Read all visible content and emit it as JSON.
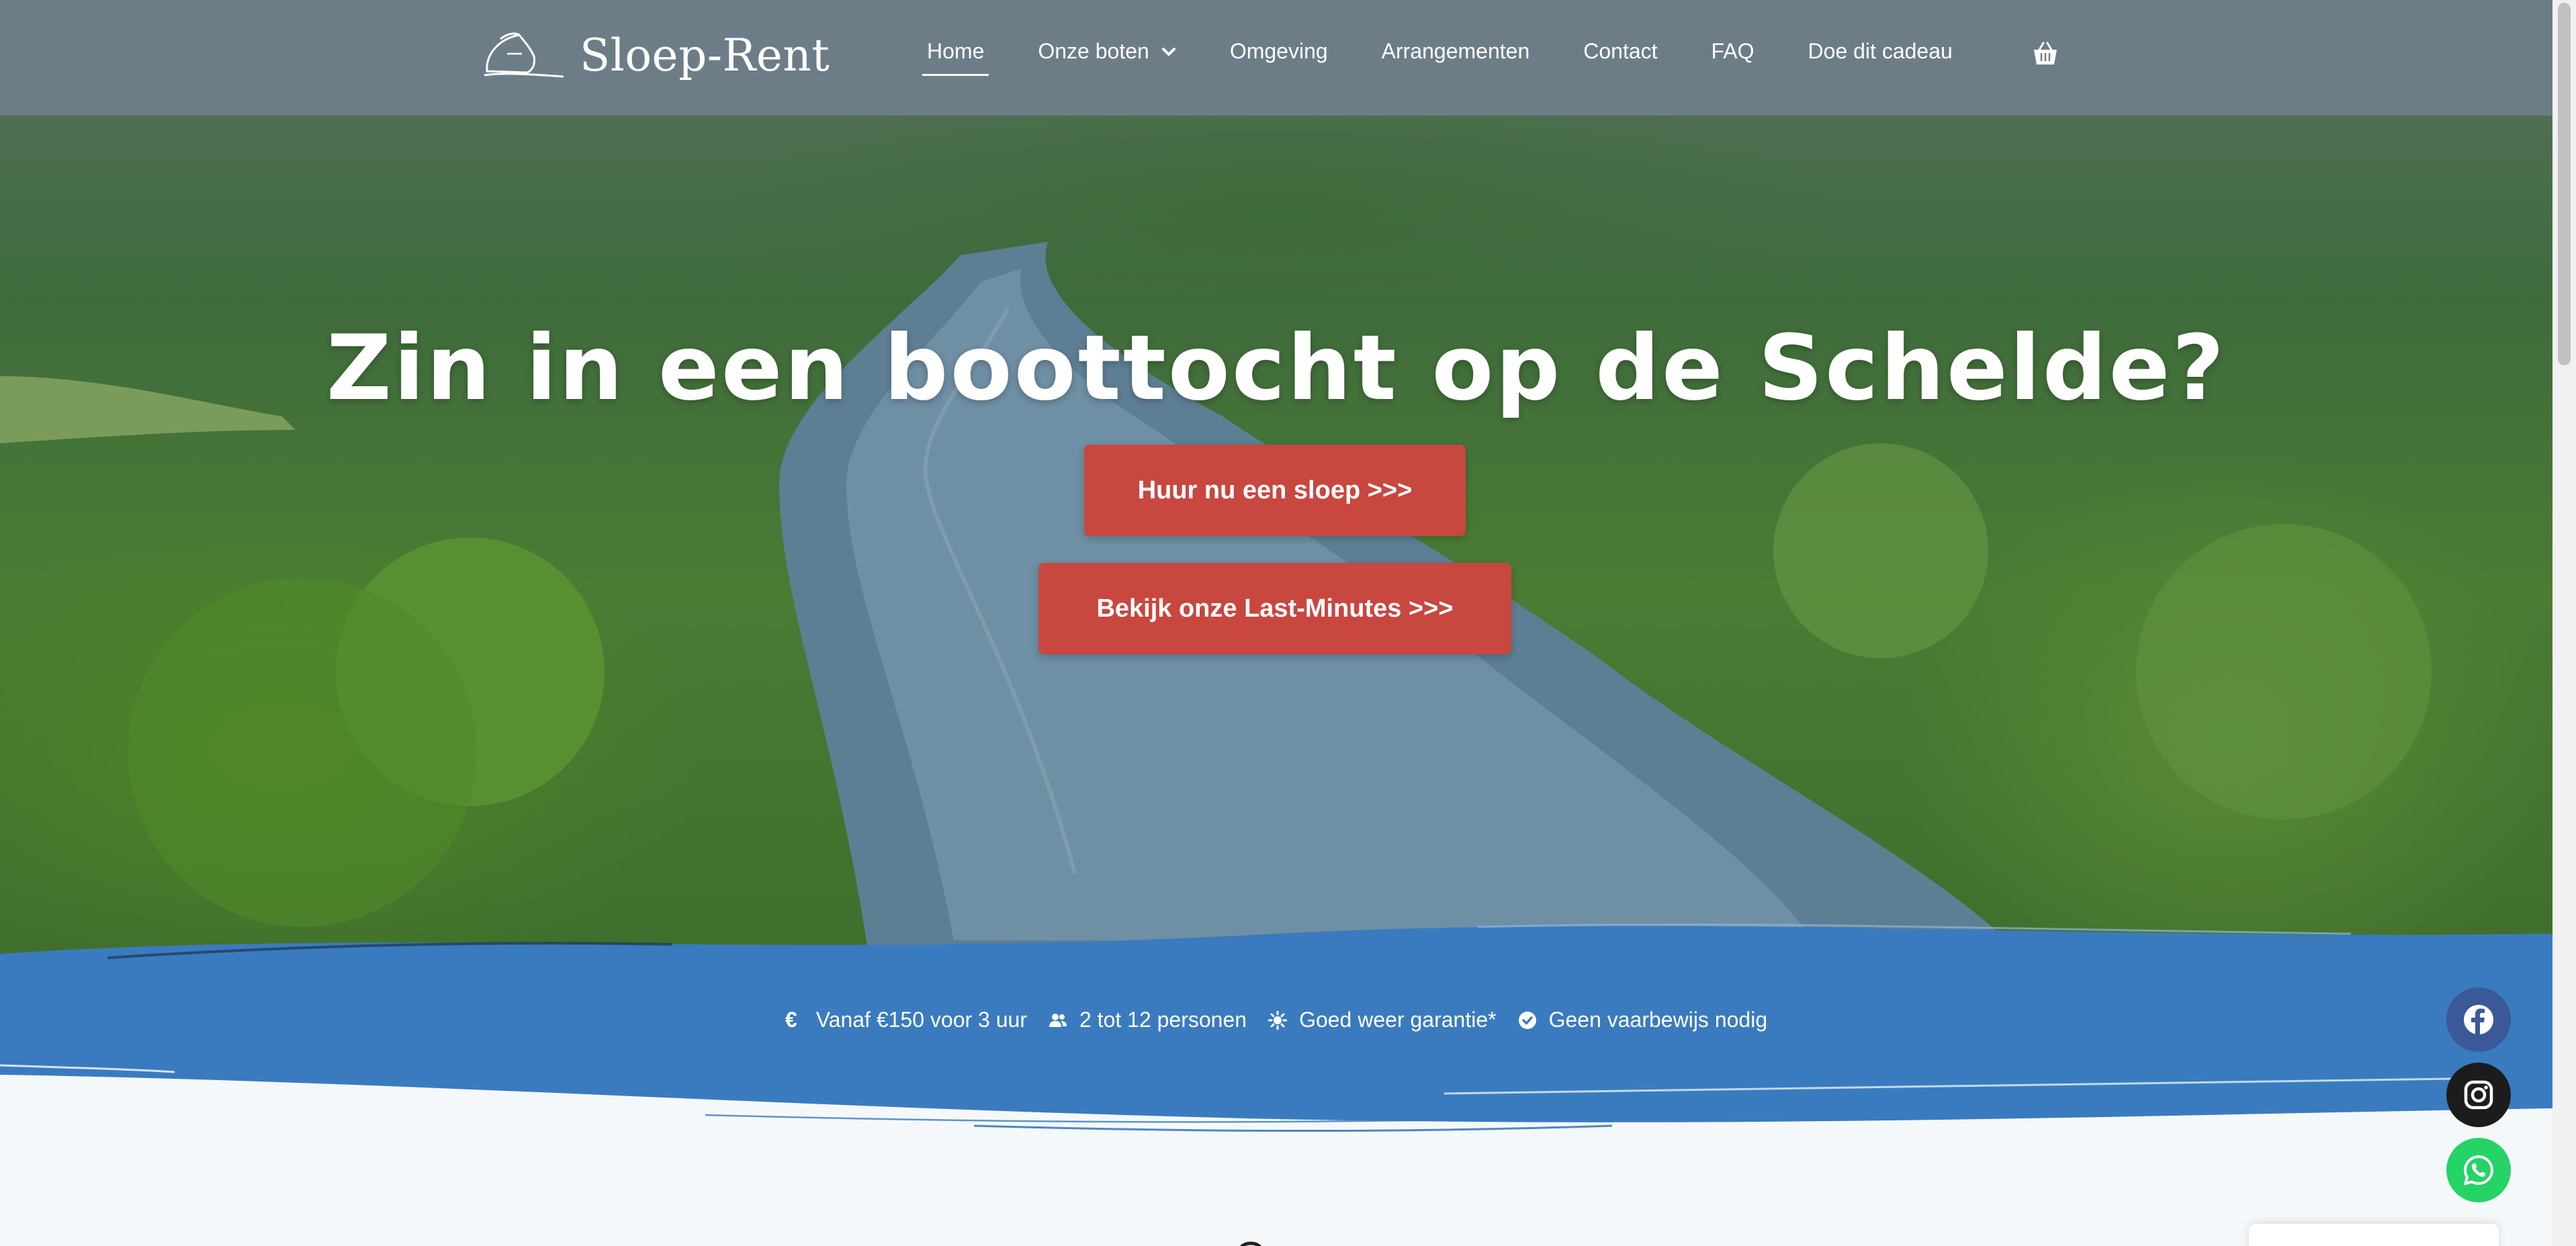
{
  "brand": {
    "name": "Sloep-Rent"
  },
  "nav": {
    "items": [
      {
        "label": "Home",
        "active": true
      },
      {
        "label": "Onze boten",
        "dropdown": true
      },
      {
        "label": "Omgeving"
      },
      {
        "label": "Arrangementen"
      },
      {
        "label": "Contact"
      },
      {
        "label": "FAQ"
      },
      {
        "label": "Doe dit cadeau"
      }
    ],
    "cart_icon": "basket-icon"
  },
  "hero": {
    "title": "Zin in een boottocht op de Schelde?",
    "primary_button": "Huur nu een sloep >>>",
    "secondary_button": "Bekijk onze Last-Minutes >>>"
  },
  "features": [
    {
      "icon": "euro-icon",
      "text": "Vanaf €150 voor 3 uur"
    },
    {
      "icon": "users-icon",
      "text": "2 tot 12 personen"
    },
    {
      "icon": "sun-icon",
      "text": "Goed weer garantie*"
    },
    {
      "icon": "check-circle-icon",
      "text": "Geen vaarbewijs nodig"
    }
  ],
  "social": [
    {
      "icon": "facebook-icon"
    },
    {
      "icon": "instagram-icon"
    },
    {
      "icon": "whatsapp-icon"
    }
  ],
  "colors": {
    "header": "#6d7d87",
    "cta": "#c8473f",
    "wave_blue": "#3a7bbf",
    "facebook": "#3b5998",
    "whatsapp": "#25d366"
  }
}
